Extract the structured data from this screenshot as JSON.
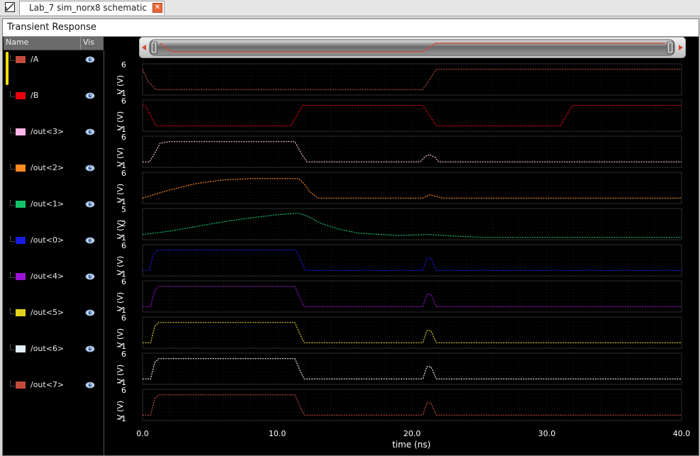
{
  "tab": {
    "title": "Lab_7 sim_norx8 schematic",
    "close_glyph": "✕"
  },
  "window_title": "Transient Response",
  "columns": {
    "name": "Name",
    "vis": "Vis"
  },
  "icons": {
    "tab": "schematic-icon",
    "visibility": "eye-icon"
  },
  "signals": [
    {
      "name": "/A",
      "color": "#c24a3a"
    },
    {
      "name": "/B",
      "color": "#e8000c"
    },
    {
      "name": "/out<3>",
      "color": "#ffb6e6"
    },
    {
      "name": "/out<2>",
      "color": "#ff8a1e"
    },
    {
      "name": "/out<1>",
      "color": "#14c26a"
    },
    {
      "name": "/out<0>",
      "color": "#1a1adf"
    },
    {
      "name": "/out<4>",
      "color": "#9a12d4"
    },
    {
      "name": "/out<5>",
      "color": "#e0d21e"
    },
    {
      "name": "/out<6>",
      "color": "#e4eefc"
    },
    {
      "name": "/out<7>",
      "color": "#c24a3a"
    }
  ],
  "chart_data": {
    "type": "line",
    "xlabel": "time (ns)",
    "xlim": [
      0,
      40
    ],
    "xticks": [
      "0.0",
      "10.0",
      "20.0",
      "30.0",
      "40.0"
    ],
    "ylabel": "V (V)",
    "grid": true,
    "series": [
      {
        "name": "/A",
        "yticks": [
          "6",
          "-1"
        ],
        "ylim": [
          -1,
          6
        ],
        "x": [
          0,
          0.4,
          1.0,
          20.8,
          21.8,
          40
        ],
        "y": [
          5,
          2,
          0,
          0,
          5,
          5
        ]
      },
      {
        "name": "/B",
        "yticks": [
          "6",
          "-1"
        ],
        "ylim": [
          -1,
          6
        ],
        "x": [
          0,
          0.2,
          1.0,
          11.0,
          11.9,
          20.8,
          21.8,
          31.0,
          31.9,
          40
        ],
        "y": [
          5,
          5,
          0,
          0,
          5,
          5,
          0,
          0,
          5,
          5
        ]
      },
      {
        "name": "/out<3>",
        "yticks": [
          "6",
          "-1"
        ],
        "ylim": [
          -1,
          6
        ],
        "x": [
          0,
          0.5,
          0.8,
          1.3,
          2.0,
          11.3,
          11.8,
          12.2,
          20.6,
          21.0,
          21.3,
          21.7,
          22.0,
          40
        ],
        "y": [
          0,
          0,
          1.5,
          4.6,
          5,
          5,
          2,
          0,
          0,
          1.4,
          1.8,
          1.1,
          0,
          0
        ]
      },
      {
        "name": "/out<2>",
        "yticks": [
          "6",
          "-1"
        ],
        "ylim": [
          -1,
          6
        ],
        "x": [
          0,
          2,
          4,
          6,
          8,
          11.6,
          12.0,
          12.4,
          13.0,
          20.8,
          21.3,
          22.3,
          40
        ],
        "y": [
          0,
          2.0,
          3.6,
          4.5,
          4.8,
          4.8,
          3.5,
          1.6,
          0,
          0,
          0.8,
          0,
          0
        ]
      },
      {
        "name": "/out<1>",
        "yticks": [
          "5",
          "2",
          "-1"
        ],
        "ylim": [
          -1,
          5
        ],
        "x": [
          0,
          2,
          4,
          6,
          8,
          10,
          11.6,
          12.3,
          13.2,
          14.5,
          16,
          19,
          21.2,
          23,
          25,
          40
        ],
        "y": [
          -0.2,
          0.5,
          1.5,
          2.5,
          3.3,
          4.0,
          4.3,
          3.6,
          2.2,
          1.0,
          0.1,
          -0.4,
          -0.2,
          -0.5,
          -0.8,
          -0.8
        ]
      },
      {
        "name": "/out<0>",
        "yticks": [
          "6",
          "-1"
        ],
        "ylim": [
          -1,
          6
        ],
        "x": [
          0,
          0.5,
          0.8,
          1.1,
          11.4,
          11.8,
          12.1,
          20.8,
          21.1,
          21.4,
          21.8,
          40
        ],
        "y": [
          0,
          0,
          4,
          5,
          5,
          2,
          0,
          0,
          3,
          3,
          0,
          0
        ]
      },
      {
        "name": "/out<4>",
        "yticks": [
          "6",
          "-1"
        ],
        "ylim": [
          -1,
          6
        ],
        "x": [
          0,
          0.6,
          0.9,
          1.2,
          11.3,
          11.7,
          12.0,
          20.8,
          21.1,
          21.4,
          21.8,
          40
        ],
        "y": [
          0,
          0,
          4,
          5,
          5,
          2,
          0,
          0,
          3,
          3,
          0,
          0
        ]
      },
      {
        "name": "/out<5>",
        "yticks": [
          "6",
          "-1"
        ],
        "ylim": [
          -1,
          6
        ],
        "x": [
          0,
          0.6,
          0.9,
          1.2,
          11.3,
          11.7,
          12.0,
          20.8,
          21.1,
          21.4,
          21.8,
          40
        ],
        "y": [
          0,
          0,
          4,
          5,
          5,
          2,
          0,
          0,
          3,
          3,
          0,
          0
        ]
      },
      {
        "name": "/out<6>",
        "yticks": [
          "6",
          "-1"
        ],
        "ylim": [
          -1,
          6
        ],
        "x": [
          0,
          0.6,
          0.9,
          1.2,
          11.3,
          11.7,
          12.0,
          20.8,
          21.1,
          21.4,
          21.8,
          40
        ],
        "y": [
          0,
          0,
          4,
          5,
          5,
          2,
          0,
          0,
          3,
          3,
          0,
          0
        ]
      },
      {
        "name": "/out<7>",
        "yticks": [
          "6",
          "-1"
        ],
        "ylim": [
          -1,
          6
        ],
        "x": [
          0,
          0.6,
          0.9,
          1.2,
          11.3,
          11.7,
          12.0,
          20.8,
          21.1,
          21.4,
          21.8,
          40
        ],
        "y": [
          0,
          0,
          4,
          5,
          5,
          2,
          0,
          0,
          3,
          3,
          0,
          0
        ]
      }
    ]
  }
}
